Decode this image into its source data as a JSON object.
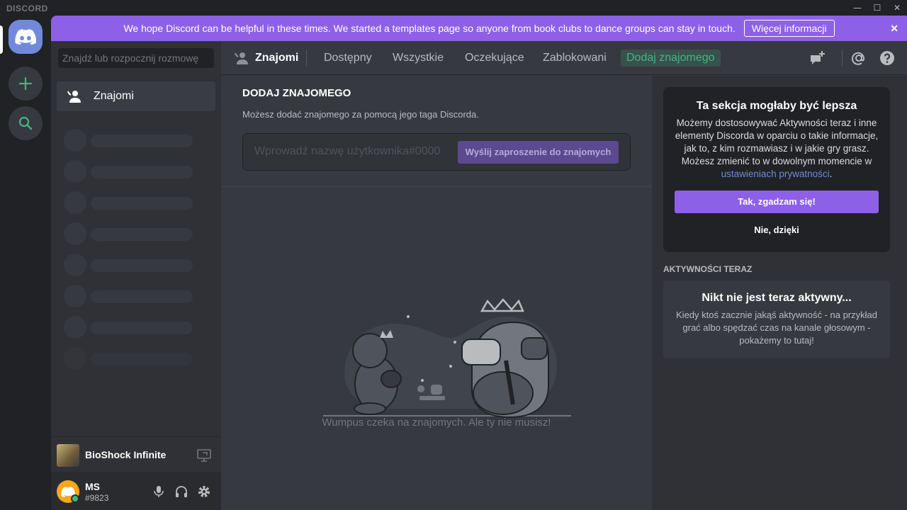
{
  "titlebar": {
    "brand": "DISCORD",
    "minimize": "—",
    "maximize": "☐",
    "close": "✕"
  },
  "guilds": {
    "home_icon": "discord-logo-icon",
    "add_icon": "plus-icon",
    "explore_icon": "search-icon"
  },
  "notice": {
    "text": "We hope Discord can be helpful in these times. We started a templates page so anyone from book clubs to dance groups can stay in touch.",
    "button_label": "Więcej informacji",
    "close": "✕"
  },
  "sidebar": {
    "search_placeholder": "Znajdź lub rozpocznij rozmowę",
    "friends_label": "Znajomi",
    "skeleton_rows": 8
  },
  "activity": {
    "game_name": "BioShock Infinite"
  },
  "user": {
    "name": "MS",
    "tag": "#9823",
    "status": "online"
  },
  "topbar": {
    "title": "Znajomi",
    "tabs": [
      "Dostępny",
      "Wszystkie",
      "Oczekujące",
      "Zablokowani"
    ],
    "add_friend_tab": "Dodaj znajomego"
  },
  "add_friend": {
    "title": "DODAJ ZNAJOMEGO",
    "description": "Możesz dodać znajomego za pomocą jego taga Discorda.",
    "input_placeholder": "Wprowadź nazwę użytkownika#0000",
    "send_button": "Wyślij zaproszenie do znajomych"
  },
  "empty_state": {
    "text": "Wumpus czeka na znajomych. Ale ty nie musisz!"
  },
  "privacy_card": {
    "title": "Ta sekcja mogłaby być lepsza",
    "text_before_link": "Możemy dostosowywać Aktywności teraz i inne elementy Discorda w oparciu o takie informacje, jak to, z kim rozmawiasz i w jakie gry grasz. Możesz zmienić to w dowolnym momencie w ",
    "link_text": "ustawieniach prywatności",
    "text_after_link": ".",
    "accept_button": "Tak, zgadzam się!",
    "decline_button": "Nie, dzięki"
  },
  "activity_now": {
    "section_title": "AKTYWNOŚCI TERAZ",
    "empty_title": "Nikt nie jest teraz aktywny...",
    "empty_text": "Kiedy ktoś zacznie jakąś aktywność - na przykład grać albo spędzać czas na kanale głosowym - pokażemy to tutaj!"
  },
  "colors": {
    "accent": "#8e60e8",
    "online": "#43b581",
    "add_friend_green": "#43b581",
    "avatar": "#faa61a"
  }
}
